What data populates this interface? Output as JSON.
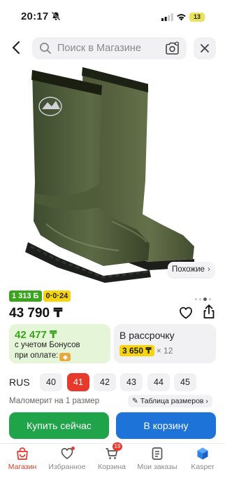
{
  "status": {
    "time": "20:17",
    "battery": "13"
  },
  "search": {
    "placeholder": "Поиск в Магазине"
  },
  "product": {
    "similar_label": "Похожие",
    "badges": {
      "bonus_tag": "1 313 Б",
      "installment_tag": "0·0·24"
    },
    "price": "43 790 ₸",
    "bonus_card": {
      "amount": "42 477 ₸",
      "line1": "с учетом Бонусов",
      "line2": "при оплате:"
    },
    "installment_card": {
      "title": "В рассрочку",
      "monthly": "3 650 ₸",
      "months": "× 12"
    },
    "sizes": {
      "system": "RUS",
      "options": [
        "40",
        "41",
        "42",
        "43",
        "44",
        "45"
      ],
      "selected": "41"
    },
    "fit_note": "Маломерит на 1 размер",
    "size_chart_label": "Таблица размеров",
    "buy_now_label": "Купить сейчас",
    "add_to_cart_label": "В корзину"
  },
  "tabbar": {
    "items": [
      {
        "label": "Магазин",
        "icon": "shop-bag-icon",
        "active": true
      },
      {
        "label": "Избранное",
        "icon": "heart-icon"
      },
      {
        "label": "Корзина",
        "icon": "cart-icon",
        "count": "19"
      },
      {
        "label": "Мои заказы",
        "icon": "orders-icon"
      },
      {
        "label": "Kasper",
        "icon": "kasper-cube-icon"
      }
    ]
  },
  "colors": {
    "accent_red": "#e83a2c",
    "buy_green": "#1fa44a",
    "cart_blue": "#1e73d8",
    "bonus_green": "#36a51a",
    "promo_yellow": "#f7d40c",
    "boot_olive": "#4e5a3b"
  }
}
